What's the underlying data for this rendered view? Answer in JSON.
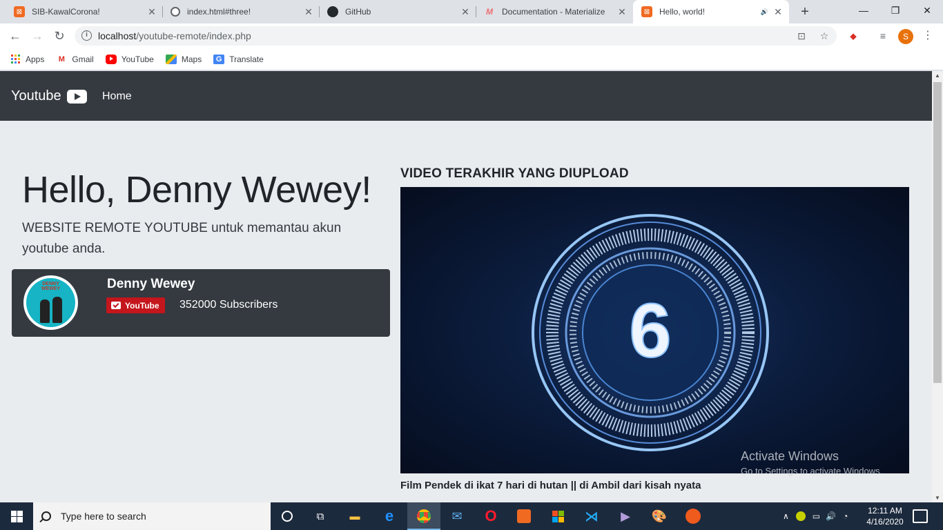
{
  "browser": {
    "tabs": [
      {
        "title": "SIB-KawalCorona!",
        "icon": "xampp-icon"
      },
      {
        "title": "index.html#three!",
        "icon": "globe-icon"
      },
      {
        "title": "GitHub",
        "icon": "github-icon"
      },
      {
        "title": "Documentation - Materialize",
        "icon": "materialize-icon"
      },
      {
        "title": "Hello, world!",
        "icon": "xampp-icon",
        "active": true
      }
    ],
    "url_host": "localhost",
    "url_path": "/youtube-remote/index.php",
    "profile_initial": "S",
    "bookmarks": [
      {
        "label": "Apps"
      },
      {
        "label": "Gmail"
      },
      {
        "label": "YouTube"
      },
      {
        "label": "Maps"
      },
      {
        "label": "Translate"
      }
    ]
  },
  "navbar": {
    "brand": "Youtube",
    "home": "Home"
  },
  "jumbotron": {
    "heading": "Hello, Denny Wewey!",
    "lead": "WEBSITE REMOTE YOUTUBE untuk memantau akun youtube anda."
  },
  "channel": {
    "avatar_text_1": "DENNY",
    "avatar_text_2": "WEWEY",
    "name": "Denny Wewey",
    "subscribe_label": "YouTube",
    "subscribers": "352000 Subscribers"
  },
  "video": {
    "heading": "VIDEO TERAKHIR YANG DIUPLOAD",
    "thumbnail_number": "6",
    "title": "Film Pendek di ikat 7 hari di hutan || di Ambil dari kisah nyata"
  },
  "watermark": {
    "line1": "Activate Windows",
    "line2": "Go to Settings to activate Windows."
  },
  "taskbar": {
    "search_placeholder": "Type here to search",
    "time": "12:11 AM",
    "date": "4/16/2020"
  },
  "colors": {
    "navbar_bg": "#343a40",
    "page_bg": "#e9ecef",
    "youtube_red": "#c4161c"
  }
}
